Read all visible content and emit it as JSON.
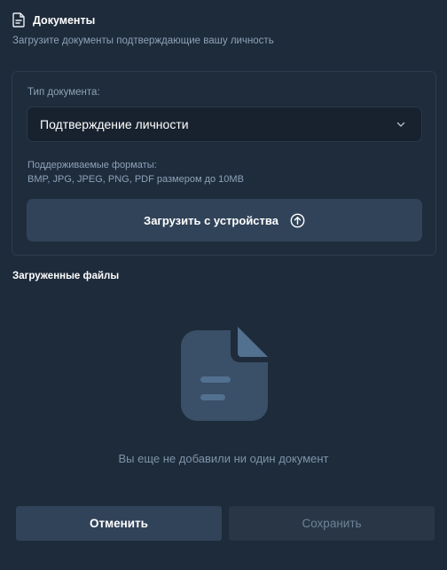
{
  "header": {
    "title": "Документы",
    "subtitle": "Загрузите документы подтверждающие вашу личность"
  },
  "form": {
    "doc_type_label": "Тип документа:",
    "doc_type_selected": "Подтверждение личности",
    "formats_line1": "Поддерживаемые форматы:",
    "formats_line2": "BMP, JPG, JPEG, PNG, PDF размером до 10MB",
    "upload_label": "Загрузить с устройства"
  },
  "files": {
    "title": "Загруженные файлы",
    "empty_text": "Вы еще не добавили ни один документ"
  },
  "footer": {
    "cancel_label": "Отменить",
    "save_label": "Сохранить"
  },
  "icons": {
    "header": "document-icon",
    "select": "chevron-down-icon",
    "upload": "upload-circle-icon",
    "empty": "empty-document-icon"
  },
  "colors": {
    "background": "#1e2b3a",
    "card_border": "#2c3b4c",
    "button_primary": "#314359",
    "button_disabled": "#283646",
    "muted_text": "#8ea2b8",
    "empty_icon": "#3a4f68",
    "empty_icon_accent": "#52708f"
  }
}
